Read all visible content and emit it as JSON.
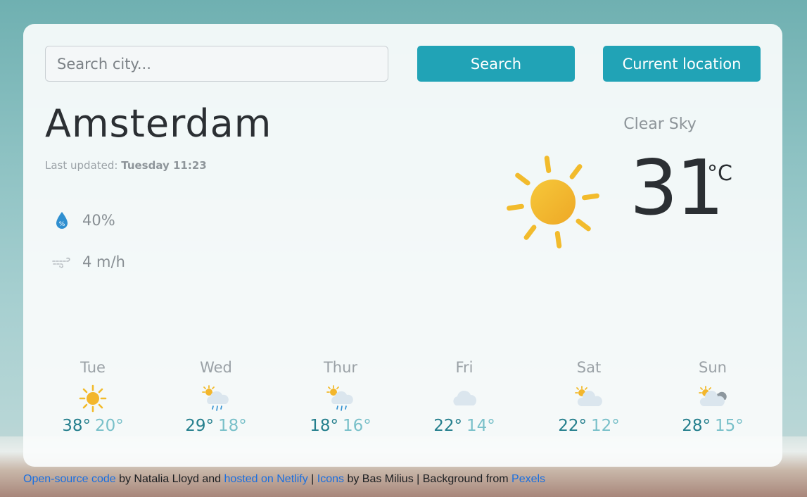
{
  "search": {
    "placeholder": "Search city...",
    "value": "",
    "search_label": "Search",
    "location_label": "Current location"
  },
  "current": {
    "city": "Amsterdam",
    "updated_label": "Last updated:",
    "updated_value": "Tuesday 11:23",
    "humidity": "40%",
    "humidity_icon": "humidity-drop-icon",
    "wind": "4 m/h",
    "wind_icon": "wind-icon",
    "description": "Clear Sky",
    "temperature": "31",
    "unit": "°C",
    "icon": "sun-icon"
  },
  "forecast": [
    {
      "day": "Tue",
      "high": "38°",
      "low": "20°",
      "icon": "sun-icon"
    },
    {
      "day": "Wed",
      "high": "29°",
      "low": "18°",
      "icon": "partly-sunny-rain-icon"
    },
    {
      "day": "Thur",
      "high": "18°",
      "low": "16°",
      "icon": "partly-sunny-rain-icon"
    },
    {
      "day": "Fri",
      "high": "22°",
      "low": "14°",
      "icon": "cloud-icon"
    },
    {
      "day": "Sat",
      "high": "22°",
      "low": "12°",
      "icon": "partly-cloudy-icon"
    },
    {
      "day": "Sun",
      "high": "28°",
      "low": "15°",
      "icon": "partly-cloudy-dark-icon"
    }
  ],
  "footer": {
    "link1": "Open-source code",
    "text1": " by Natalia Lloyd and ",
    "link2": "hosted on Netlify",
    "sep1": " | ",
    "link3": "Icons",
    "text2": " by Bas Milius | Background from ",
    "link4": "Pexels"
  },
  "colors": {
    "accent": "#21a3b6",
    "high_temp": "#257f8d",
    "low_temp": "#79c0c9",
    "link": "#1a6fe0"
  }
}
